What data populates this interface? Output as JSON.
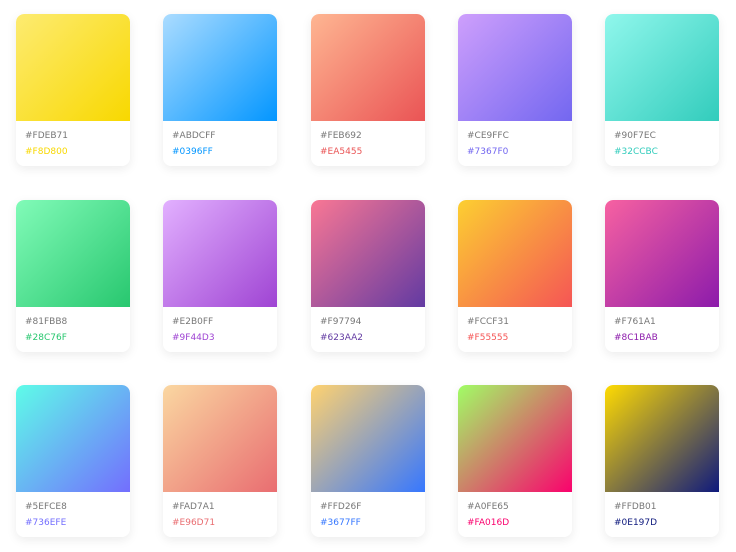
{
  "palettes": [
    {
      "from": "#FDEB71",
      "to": "#F8D800"
    },
    {
      "from": "#ABDCFF",
      "to": "#0396FF"
    },
    {
      "from": "#FEB692",
      "to": "#EA5455"
    },
    {
      "from": "#CE9FFC",
      "to": "#7367F0"
    },
    {
      "from": "#90F7EC",
      "to": "#32CCBC"
    },
    {
      "from": "#81FBB8",
      "to": "#28C76F"
    },
    {
      "from": "#E2B0FF",
      "to": "#9F44D3"
    },
    {
      "from": "#F97794",
      "to": "#623AA2"
    },
    {
      "from": "#FCCF31",
      "to": "#F55555"
    },
    {
      "from": "#F761A1",
      "to": "#8C1BAB"
    },
    {
      "from": "#5EFCE8",
      "to": "#736EFE"
    },
    {
      "from": "#FAD7A1",
      "to": "#E96D71"
    },
    {
      "from": "#FFD26F",
      "to": "#3677FF"
    },
    {
      "from": "#A0FE65",
      "to": "#FA016D"
    },
    {
      "from": "#FFDB01",
      "to": "#0E197D"
    }
  ]
}
